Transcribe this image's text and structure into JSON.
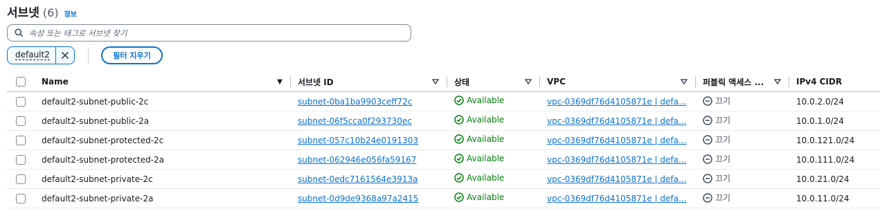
{
  "header": {
    "title": "서브넷",
    "count": "(6)",
    "info_link": "정보"
  },
  "search": {
    "placeholder": "속성 또는 태그로 서브넷 찾기"
  },
  "filter": {
    "token_label": "default2",
    "clear_label": "필터 지우기"
  },
  "table": {
    "columns": {
      "name": "Name",
      "subnet_id": "서브넷 ID",
      "state": "상태",
      "vpc": "VPC",
      "public_access": "퍼블릭 액세스 ...",
      "ipv4_cidr": "IPv4 CIDR"
    },
    "rows": [
      {
        "name": "default2-subnet-public-2c",
        "subnet_id": "subnet-0ba1ba9903ceff72c",
        "state": "Available",
        "vpc": "vpc-0369df76d4105871e | defa...",
        "public_access": "끄기",
        "ipv4_cidr": "10.0.2.0/24"
      },
      {
        "name": "default2-subnet-public-2a",
        "subnet_id": "subnet-06f5cca0f293730ec",
        "state": "Available",
        "vpc": "vpc-0369df76d4105871e | defa...",
        "public_access": "끄기",
        "ipv4_cidr": "10.0.1.0/24"
      },
      {
        "name": "default2-subnet-protected-2c",
        "subnet_id": "subnet-057c10b24e0191303",
        "state": "Available",
        "vpc": "vpc-0369df76d4105871e | defa...",
        "public_access": "끄기",
        "ipv4_cidr": "10.0.121.0/24"
      },
      {
        "name": "default2-subnet-protected-2a",
        "subnet_id": "subnet-062946e056fa59167",
        "state": "Available",
        "vpc": "vpc-0369df76d4105871e | defa...",
        "public_access": "끄기",
        "ipv4_cidr": "10.0.111.0/24"
      },
      {
        "name": "default2-subnet-private-2c",
        "subnet_id": "subnet-0edc7161564e3913a",
        "state": "Available",
        "vpc": "vpc-0369df76d4105871e | defa...",
        "public_access": "끄기",
        "ipv4_cidr": "10.0.21.0/24"
      },
      {
        "name": "default2-subnet-private-2a",
        "subnet_id": "subnet-0d9de9368a97a2415",
        "state": "Available",
        "vpc": "vpc-0369df76d4105871e | defa...",
        "public_access": "끄기",
        "ipv4_cidr": "10.0.11.0/24"
      }
    ]
  },
  "colors": {
    "link": "#0972d3",
    "success": "#037f0c",
    "border": "#b6bec9"
  },
  "icons": {
    "search": "search-icon",
    "close": "close-icon",
    "sort": "sort-icon",
    "status_ok": "check-circle-icon",
    "off": "minus-circle-icon"
  }
}
